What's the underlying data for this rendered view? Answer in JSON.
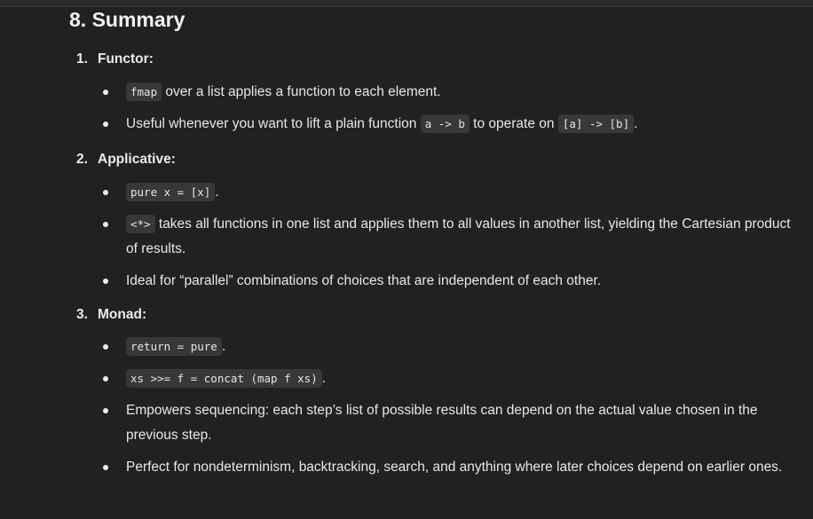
{
  "heading": "8. Summary",
  "sections": [
    {
      "num": "1.",
      "title": "Functor",
      "items": [
        {
          "code1": "fmap",
          "text1": " over a list applies a function to each element."
        },
        {
          "text1": "Useful whenever you want to lift a plain function ",
          "code1": "a -> b",
          "text2": " to operate on ",
          "code2": "[a] -> [b]",
          "text3": "."
        }
      ]
    },
    {
      "num": "2.",
      "title": "Applicative",
      "items": [
        {
          "code1": "pure x = [x]",
          "text1": "."
        },
        {
          "code1": "<*>",
          "text1": " takes all functions in one list and applies them to all values in another list, yielding the Cartesian product of results."
        },
        {
          "text1": "Ideal for “parallel” combinations of choices that are independent of each other."
        }
      ]
    },
    {
      "num": "3.",
      "title": "Monad",
      "items": [
        {
          "code1": "return = pure",
          "text1": "."
        },
        {
          "code1": "xs >>= f = concat (map f xs)",
          "text1": "."
        },
        {
          "text1": "Empowers sequencing: each step’s list of possible results can depend on the actual value chosen in the previous step."
        },
        {
          "text1": "Perfect for nondeterminism, backtracking, search, and anything where later choices depend on earlier ones."
        }
      ]
    }
  ]
}
